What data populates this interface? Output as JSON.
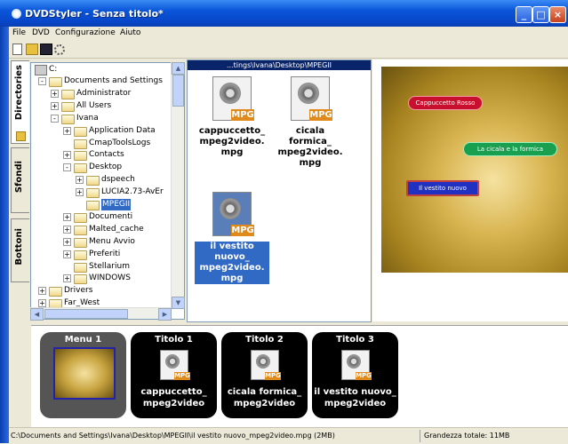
{
  "window": {
    "title": "DVDStyler - Senza titolo*"
  },
  "menubar": [
    "File",
    "DVD",
    "Configurazione",
    "Aiuto"
  ],
  "tabs": [
    "Directories",
    "Sfondi",
    "Bottoni"
  ],
  "tree": {
    "root": "C:",
    "rows": [
      {
        "label": "Documents and Settings",
        "level": 1,
        "exp": "-"
      },
      {
        "label": "Administrator",
        "level": 2,
        "exp": "+"
      },
      {
        "label": "All Users",
        "level": 2,
        "exp": "+"
      },
      {
        "label": "Ivana",
        "level": 2,
        "exp": "-"
      },
      {
        "label": "Application Data",
        "level": 3,
        "exp": "+"
      },
      {
        "label": "CmapToolsLogs",
        "level": 3,
        "exp": ""
      },
      {
        "label": "Contacts",
        "level": 3,
        "exp": "+"
      },
      {
        "label": "Desktop",
        "level": 3,
        "exp": "-"
      },
      {
        "label": "dspeech",
        "level": 4,
        "exp": "+"
      },
      {
        "label": "LUCIA2.73-AvEr",
        "level": 4,
        "exp": "+"
      },
      {
        "label": "MPEGII",
        "level": 4,
        "exp": "",
        "selected": true
      },
      {
        "label": "Documenti",
        "level": 3,
        "exp": "+"
      },
      {
        "label": "Malted_cache",
        "level": 3,
        "exp": "+"
      },
      {
        "label": "Menu Avvio",
        "level": 3,
        "exp": "+"
      },
      {
        "label": "Preferiti",
        "level": 3,
        "exp": "+"
      },
      {
        "label": "Stellarium",
        "level": 3,
        "exp": ""
      },
      {
        "label": "WINDOWS",
        "level": 3,
        "exp": "+"
      },
      {
        "label": "Drivers",
        "level": 1,
        "exp": "+"
      },
      {
        "label": "Far_West",
        "level": 1,
        "exp": "+"
      }
    ]
  },
  "filepane": {
    "path": "...tings\\Ivana\\Desktop\\MPEGII",
    "files": [
      {
        "lines": [
          "cappuccetto_",
          "mpeg2video.",
          "mpg"
        ],
        "badge": "MPG"
      },
      {
        "lines": [
          "cicala",
          "formica_",
          "mpeg2video.",
          "mpg"
        ],
        "badge": "MPG"
      },
      {
        "lines": [
          "il vestito",
          "nuovo_",
          "mpeg2video.",
          "mpg"
        ],
        "badge": "MPG",
        "selected": true
      }
    ]
  },
  "preview": {
    "buttons": [
      "Cappuccetto Rosso",
      "La cicala e la formica",
      "Il vestito nuovo"
    ]
  },
  "titleset": [
    {
      "title": "Menu 1",
      "type": "menu"
    },
    {
      "title": "Titolo 1",
      "line1": "cappuccetto_",
      "line2": "mpeg2video",
      "badge": "MPG"
    },
    {
      "title": "Titolo 2",
      "line1": "cicala formica_",
      "line2": "mpeg2video",
      "badge": "MPG"
    },
    {
      "title": "Titolo 3",
      "line1": "il vestito nuovo_",
      "line2": "mpeg2video",
      "badge": "MPG"
    }
  ],
  "status": {
    "path": "C:\\Documents and Settings\\Ivana\\Desktop\\MPEGII\\il vestito nuovo_mpeg2video.mpg (2MB)",
    "total": "Grandezza totale: 11MB"
  },
  "colors": {
    "titlebar": "#0a55d8",
    "selection": "#316ac5",
    "mpg_badge": "#e08a1c",
    "btn_red": "#c8102e",
    "btn_green": "#18a050",
    "btn_blue": "#2030c0"
  }
}
